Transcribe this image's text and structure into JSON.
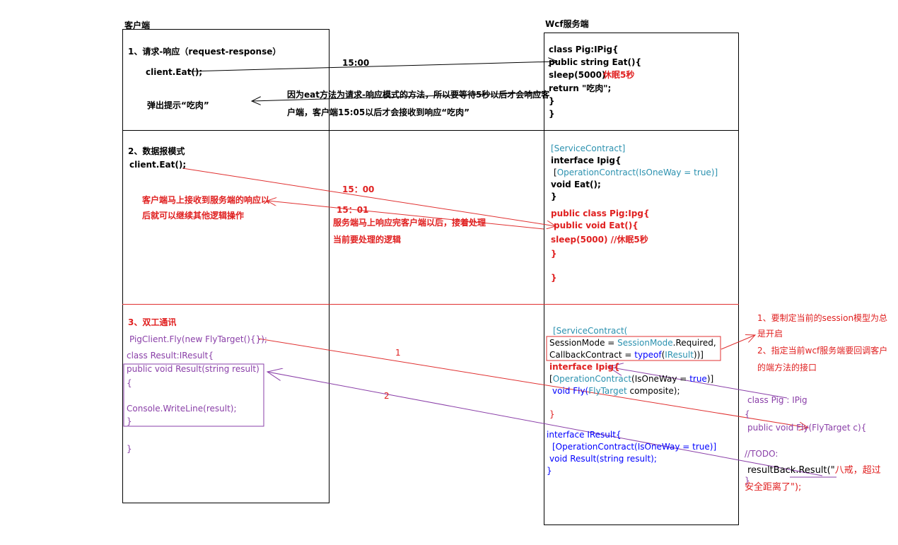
{
  "headers": {
    "client": "客户端",
    "server": "Wcf服务端"
  },
  "section1": {
    "title": "1、请求-响应（request-response）",
    "client_call": "client.Eat();",
    "popup": "弹出提示“吃肉”",
    "time": "15:00",
    "note_line1": "因为eat方法为请求-响应模式的方法，所以要等待5秒以后才会响应客",
    "note_line2": "户端，客户端15:05以后才会接收到响应“吃肉”",
    "server_code": [
      "class Pig:IPig{",
      "public string Eat(){",
      "sleep(5000)",
      "return \"吃肉\";",
      "}",
      "}"
    ],
    "sleep_comment": "休眠5秒"
  },
  "section2": {
    "title": "2、数据报模式",
    "client_call": "client.Eat();",
    "client_note_line1": "客户端马上接收到服务端的响应以",
    "client_note_line2": "后就可以继续其他逻辑操作",
    "time1": "15：00",
    "time2": "15：01",
    "server_note_line1": "服务端马上响应完客户端以后，接着处理",
    "server_note_line2": "当前要处理的逻辑",
    "attr_service": "[ServiceContract]",
    "interface_decl": "interface Ipig{",
    "attr_op_open": "[",
    "attr_op_name": "OperationContract",
    "attr_op_rest": "(IsOneWay = true)]",
    "void_eat": "void Eat();",
    "close1": "}",
    "class_decl": "public class Pig:Ipg{",
    "method_decl": "public void Eat(){",
    "sleep_line": "sleep(5000)  //休眠5秒",
    "close2": "}",
    "close3": "}"
  },
  "section3": {
    "title": "3、双工通讯",
    "client_call": "PigClient.Fly(new FlyTarget(){});",
    "class_decl": "class Result:IResult{",
    "method_decl": "public void Result(string result)",
    "open_brace": "{",
    "console_line": "Console.WriteLine(result);",
    "close_brace": "}",
    "class_close": "}",
    "arrow1_label": "1",
    "arrow2_label": "2",
    "sc_open": "[ServiceContract(",
    "session_mode_a": "SessionMode = ",
    "session_mode_b": "SessionMode",
    "session_mode_c": ".Required,",
    "callback_a": "CallbackContract = ",
    "callback_b": "typeof",
    "callback_c": "(",
    "callback_d": "IResult",
    "callback_e": "))]",
    "interface_decl": "interface Ipig{",
    "op_line_a": "[",
    "op_line_b": "OperationContract",
    "op_line_c": "(IsOneWay = ",
    "op_line_d": "true",
    "op_line_e": ")]",
    "fly_line_a": "void Fly(",
    "fly_line_b": "FlyTarget",
    "fly_line_c": " composite);",
    "close1": "}",
    "iresult_decl": "interface IResult{",
    "op2_line": "[OperationContract(IsOneWay = true)]",
    "result_method": "void Result(string result);",
    "close2": "}",
    "note1_line1": "1、要制定当前的session模型为总",
    "note1_line2": "是开启",
    "note2_line1": "2、指定当前wcf服务端要回调客户",
    "note2_line2": "的端方法的接口",
    "impl_class": "class Pig : IPig",
    "impl_open": "{",
    "impl_method": "public void Fly(FlyTarget c){",
    "todo": "//TODO:",
    "callback_line1_a": "resultBack.Result(\"",
    "callback_line1_b": "八戒，超过",
    "callback_line2": "安全距离了\");",
    "impl_close": "}"
  }
}
